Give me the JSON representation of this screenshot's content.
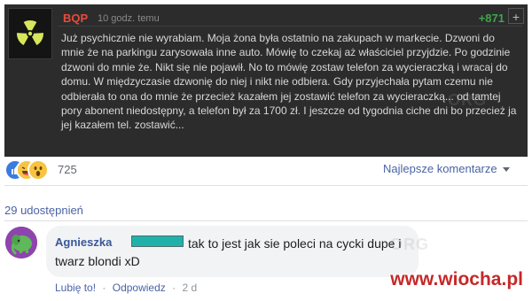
{
  "post": {
    "author": "BQP",
    "time": "10 godz. temu",
    "votes": "+871",
    "plus_label": "+",
    "body": "Już psychicznie nie wyrabiam. Moja żona była ostatnio na zakupach w markecie. Dzwoni do mnie że na parkingu zarysowała inne auto. Mówię to czekaj aż właściciel przyjdzie. Po godzinie dzwoni do mnie że. Nikt się nie pojawił. No to mówię zostaw telefon za wycieraczką i wracaj do domu. W międzyczasie dzwonię do niej i nikt nie odbiera. Gdy przyjechała pytam czemu nie odbierała to ona do mnie że przecież kazałem jej zostawić telefon za wycieraczką... od tamtej pory abonent niedostępny, a telefon był za 1700 zł. I jeszcze od tygodnia ciche dni bo przecież ja jej kazałem tel. zostawić...",
    "watermark": "ORG",
    "avatar_icon": "radioactive-icon"
  },
  "reactions": {
    "icons": [
      "like-icon",
      "haha-icon",
      "wow-icon"
    ],
    "count": "725"
  },
  "sort": {
    "label": "Najlepsze komentarze"
  },
  "shares": {
    "label": "29 udostępnień"
  },
  "comment": {
    "author": "Agnieszka",
    "text": "tak to jest jak sie poleci na cycki dupe i twarz blondi xD",
    "like_label": "Lubię to!",
    "reply_label": "Odpowiedz",
    "time": "2 d",
    "separator": "·",
    "avatar_icon": "elephant-icon",
    "redaction_color": "#20b2aa",
    "watermark": "ORG"
  },
  "watermark_logo": "www.wiocha.pl",
  "colors": {
    "post_bg": "#2c2c2c",
    "author": "#e74c3c",
    "votes": "#3fa34d",
    "link": "#4b63a6"
  }
}
